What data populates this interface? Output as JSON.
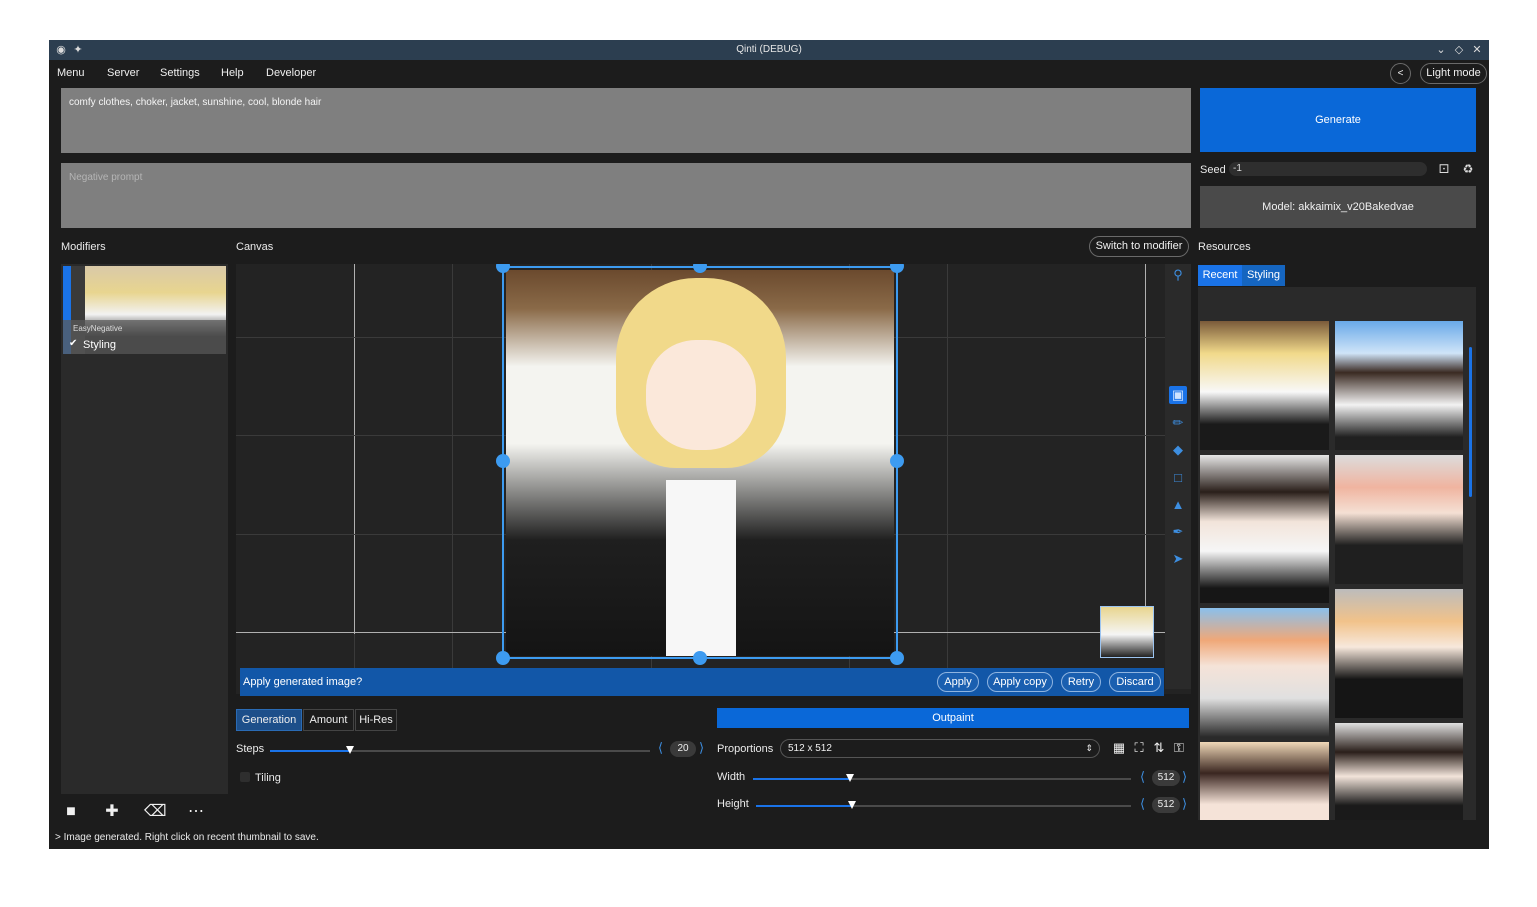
{
  "window": {
    "title": "Qinti (DEBUG)"
  },
  "menu": {
    "items": [
      "Menu",
      "Server",
      "Settings",
      "Help",
      "Developer"
    ],
    "back_label": "<",
    "theme_label": "Light mode"
  },
  "prompt": {
    "positive": "comfy clothes, choker, jacket, sunshine, cool, blonde hair",
    "negative_placeholder": "Negative prompt"
  },
  "generate_label": "Generate",
  "seed": {
    "label": "Seed",
    "value": "-1"
  },
  "model_label": "Model: akkaimix_v20Bakedvae",
  "modifiers": {
    "title": "Modifiers",
    "card": {
      "name": "EasyNegative",
      "checkbox_label": "Styling",
      "checked": true
    }
  },
  "canvas": {
    "title": "Canvas",
    "switch_label": "Switch to modifier",
    "apply_prompt": "Apply generated image?",
    "buttons": [
      "Apply",
      "Apply copy",
      "Retry",
      "Discard"
    ]
  },
  "tabs": {
    "items": [
      "Generation",
      "Amount",
      "Hi-Res"
    ],
    "active": "Generation"
  },
  "steps": {
    "label": "Steps",
    "value": "20",
    "fraction": 0.21
  },
  "tiling_label": "Tiling",
  "outpaint_label": "Outpaint",
  "proportions": {
    "label": "Proportions",
    "value": "512 x 512"
  },
  "width": {
    "label": "Width",
    "value": "512",
    "fraction": 0.26
  },
  "height": {
    "label": "Height",
    "value": "512",
    "fraction": 0.26
  },
  "resources": {
    "title": "Resources",
    "tabs": [
      "Recent",
      "Styling"
    ],
    "active_tab": "Recent"
  },
  "status": "> Image generated. Right click on recent thumbnail to save.",
  "colors": {
    "accent": "#0a68d8",
    "selection": "#3d9bf0",
    "background": "#1c1c1c"
  }
}
